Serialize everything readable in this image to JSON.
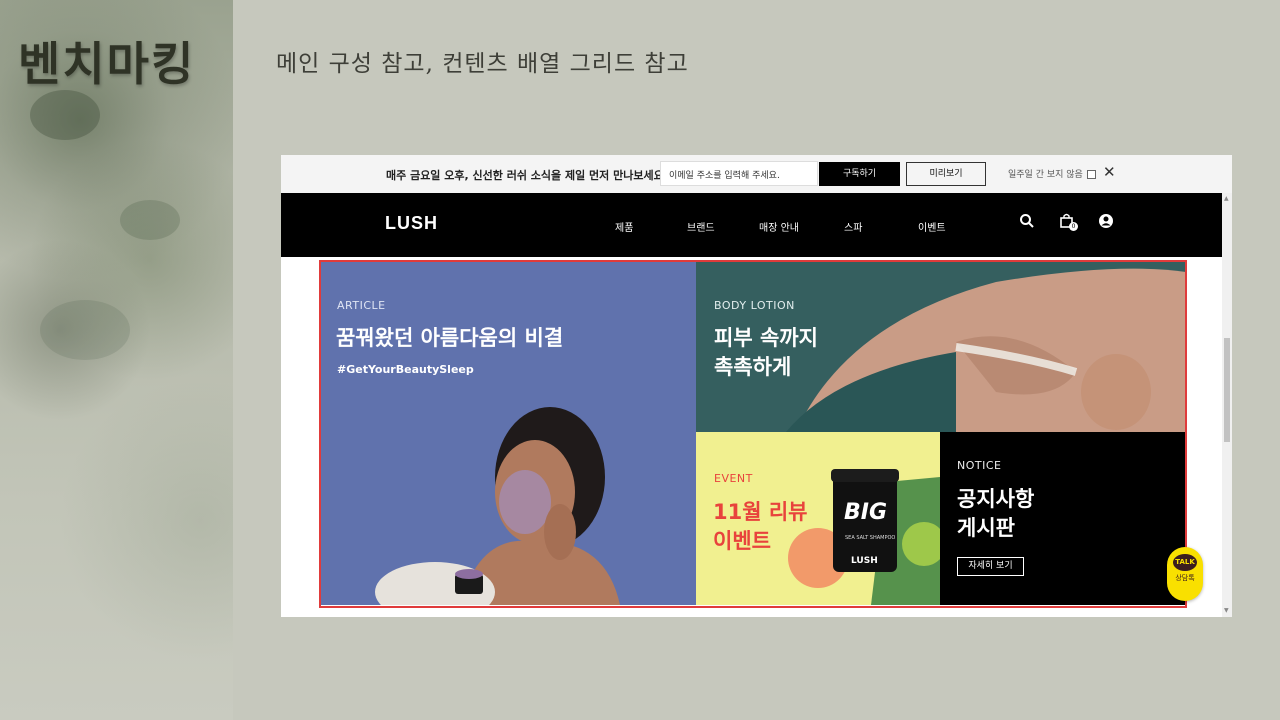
{
  "slide": {
    "title": "벤치마킹",
    "subtitle": "메인 구성 참고, 컨텐츠 배열 그리드 참고"
  },
  "topbar": {
    "message": "매주 금요일 오후, 신선한 러쉬 소식을 제일 먼저 만나보세요.",
    "email_placeholder": "이메일 주소를 입력해 주세요.",
    "subscribe_label": "구독하기",
    "preview_label": "미리보기",
    "hide_week_label": "일주일 간 보지 않음",
    "close_icon": "✕"
  },
  "navbar": {
    "logo": "LUSH",
    "menu": [
      "제품",
      "브랜드",
      "매장 안내",
      "스파",
      "이벤트"
    ],
    "cart_count": "0",
    "icons": [
      "search-icon",
      "cart-icon",
      "user-icon"
    ]
  },
  "tiles": {
    "article": {
      "category": "ARTICLE",
      "headline": "꿈꿔왔던 아름다움의 비결",
      "tag": "#GetYourBeautySleep"
    },
    "lotion": {
      "category": "BODY LOTION",
      "headline": "피부 속까지\n촉촉하게"
    },
    "event": {
      "category": "EVENT",
      "headline": "11월 리뷰\n이벤트",
      "product_label": "BIG",
      "product_sub": "SEA SALT SHAMPOO",
      "product_brand": "LUSH"
    },
    "notice": {
      "category": "NOTICE",
      "headline": "공지사항\n게시판",
      "button": "자세히 보기"
    }
  },
  "kakao": {
    "bubble": "TALK",
    "label": "상담톡"
  },
  "colors": {
    "accent_outline": "#e03b3b",
    "article_bg": "#6072ad",
    "lotion_bg": "#355f5f",
    "event_bg": "#f1f090",
    "event_text": "#e8433c",
    "notice_bg": "#000000",
    "kakao": "#f9e000"
  }
}
